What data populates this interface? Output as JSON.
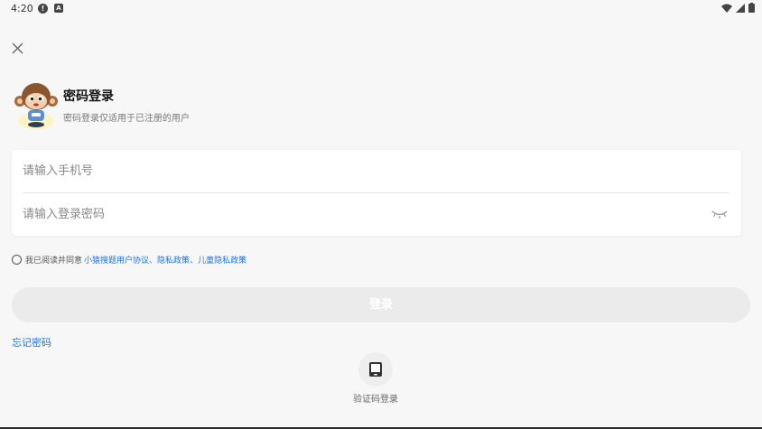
{
  "status_bar": {
    "time": "4:20",
    "alert_icon": "alert-circle-icon",
    "a_icon": "app-a-icon",
    "wifi_icon": "wifi-icon",
    "signal_icon": "signal-icon",
    "battery_icon": "battery-icon"
  },
  "close_icon": "close-icon",
  "header": {
    "title": "密码登录",
    "subtitle": "密码登录仅适用于已注册的用户"
  },
  "form": {
    "phone_placeholder": "请输入手机号",
    "password_placeholder": "请输入登录密码",
    "eye_icon": "eye-closed-icon"
  },
  "agreement": {
    "prefix": "我已阅读并同意",
    "link1": "小猿搜题用户协议",
    "sep1": "、",
    "link2": "隐私政策",
    "sep2": "、",
    "link3": "儿童隐私政策"
  },
  "login_label": "登录",
  "forgot_label": "忘记密码",
  "sms_login_label": "验证码登录",
  "colors": {
    "link": "#1a73e8",
    "background": "#f7f7f7",
    "button_disabled": "#ebebeb"
  }
}
